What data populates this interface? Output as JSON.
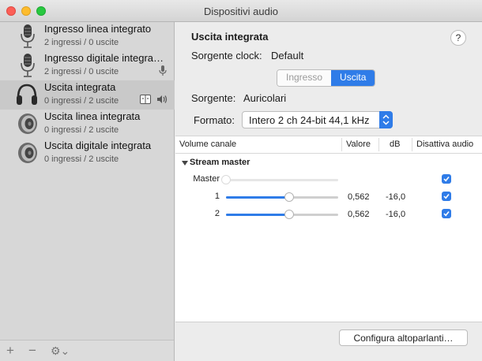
{
  "window": {
    "title": "Dispositivi audio"
  },
  "devices": [
    {
      "name": "Ingresso linea integrato",
      "sub": "2 ingressi / 0 uscite",
      "icon": "microphone-icon"
    },
    {
      "name": "Ingresso digitale integra…",
      "sub": "2 ingressi / 0 uscite",
      "icon": "microphone-icon",
      "tail": "microphone-small-icon"
    },
    {
      "name": "Uscita integrata",
      "sub": "0 ingressi / 2 uscite",
      "icon": "headphones-icon",
      "selected": true,
      "tail": "finder-icon speaker-small-icon"
    },
    {
      "name": "Uscita linea integrata",
      "sub": "0 ingressi / 2 uscite",
      "icon": "speaker-icon"
    },
    {
      "name": "Uscita digitale integrata",
      "sub": "0 ingressi / 2 uscite",
      "icon": "speaker-icon"
    }
  ],
  "sidebar_toolbar": {
    "add": "+",
    "remove": "−",
    "gear_menu": "⚙︎⌄"
  },
  "detail": {
    "title": "Uscita integrata",
    "help": "?",
    "clock_label": "Sorgente clock:",
    "clock_value": "Default",
    "tabs": [
      {
        "label": "Ingresso",
        "active": false
      },
      {
        "label": "Uscita",
        "active": true
      }
    ],
    "source_label": "Sorgente:",
    "source_value": "Auricolari",
    "format_label": "Formato:",
    "format_value": "Intero 2 ch 24-bit 44,1 kHz"
  },
  "table": {
    "headers": {
      "volume": "Volume canale",
      "value": "Valore",
      "db": "dB",
      "mute": "Disattiva audio"
    },
    "group": "Stream master",
    "rows": [
      {
        "label": "Master",
        "level": 0.0,
        "value": "",
        "db": "",
        "muted": true,
        "enabled": false
      },
      {
        "label": "1",
        "level": 0.562,
        "value": "0,562",
        "db": "-16,0",
        "muted": true,
        "enabled": true
      },
      {
        "label": "2",
        "level": 0.562,
        "value": "0,562",
        "db": "-16,0",
        "muted": true,
        "enabled": true
      }
    ]
  },
  "configure_button": "Configura altoparlanti…",
  "colors": {
    "accent": "#2f7ce8",
    "selection": "#c9c9c9",
    "sidebar": "#d7d7d7"
  }
}
